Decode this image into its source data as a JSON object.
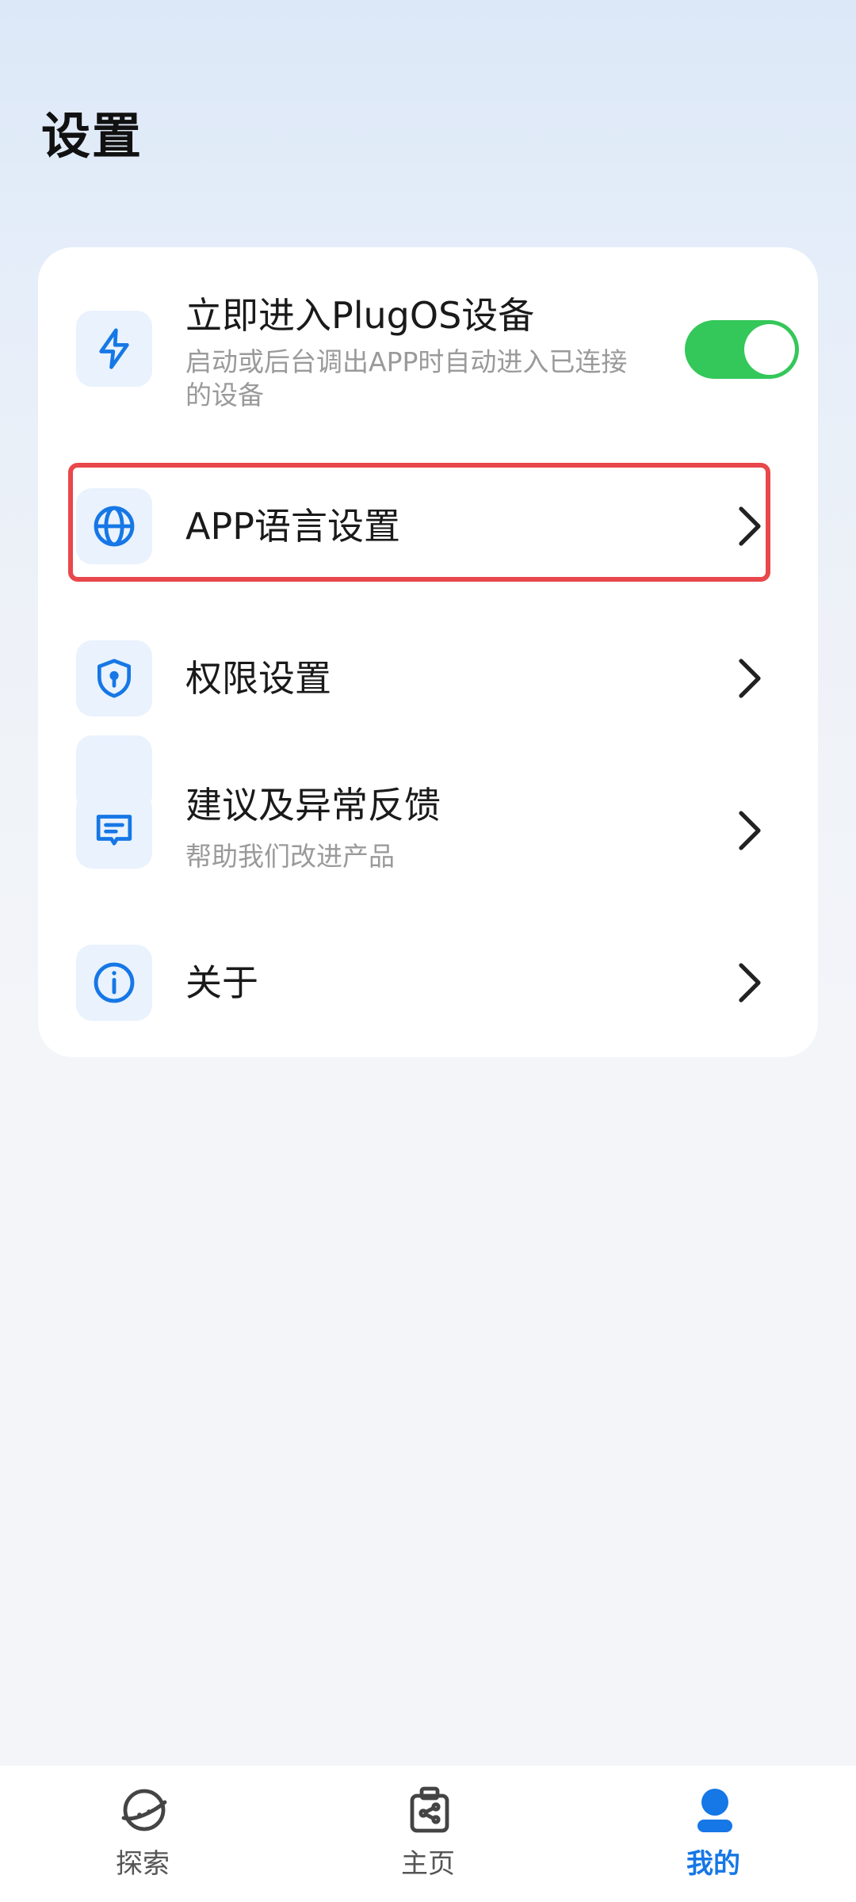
{
  "header": {
    "title": "设置"
  },
  "settings": {
    "items": [
      {
        "title": "立即进入PlugOS设备",
        "subtitle": "启动或后台调出APP时自动进入已连接的设备",
        "icon": "lightning-icon",
        "toggle_on": true
      },
      {
        "title": "APP语言设置",
        "icon": "globe-icon",
        "highlighted": true
      },
      {
        "title": "权限设置",
        "icon": "shield-lock-icon"
      },
      {
        "title": "建议及异常反馈",
        "subtitle": "帮助我们改进产品",
        "icon": "feedback-icon"
      },
      {
        "title": "关于",
        "icon": "info-icon"
      }
    ]
  },
  "tabbar": {
    "tabs": [
      {
        "label": "探索",
        "icon": "planet-icon",
        "active": false
      },
      {
        "label": "主页",
        "icon": "device-icon",
        "active": false
      },
      {
        "label": "我的",
        "icon": "person-icon",
        "active": true
      }
    ]
  },
  "colors": {
    "accent": "#1677e6",
    "toggle_on": "#34c759",
    "highlight": "#e8474b",
    "icon_bg": "#e9f2fd"
  }
}
